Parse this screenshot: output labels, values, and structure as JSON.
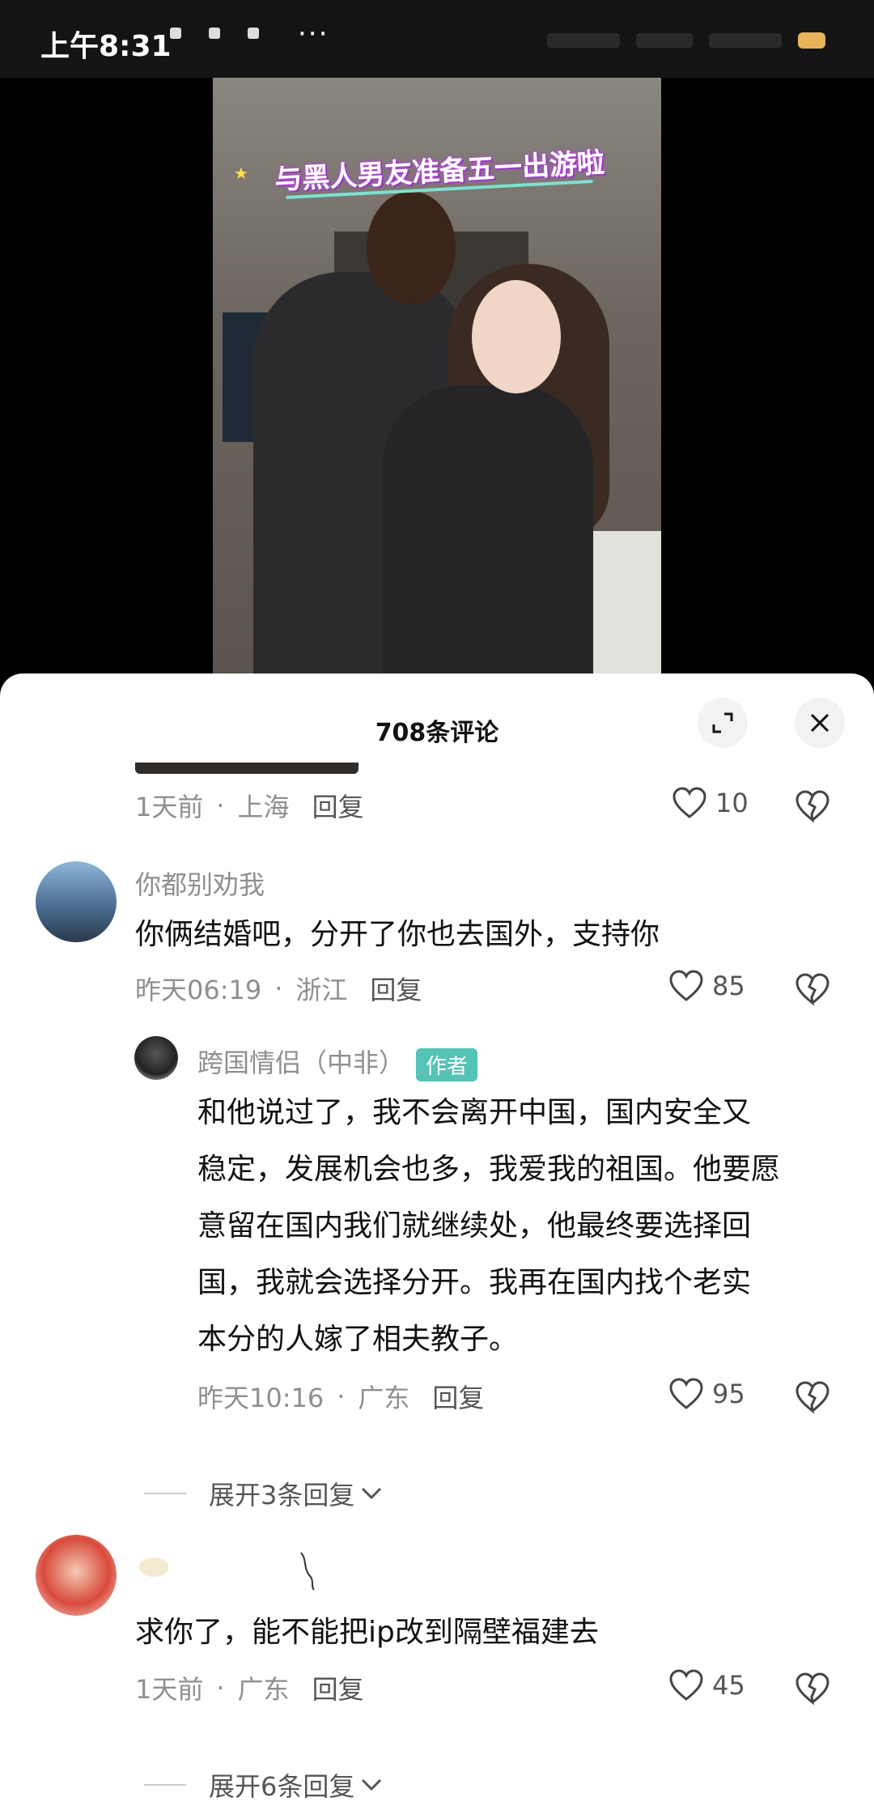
{
  "status_bar": {
    "time": "上午8:31",
    "more": "···"
  },
  "video": {
    "caption": "与黑人男友准备五一出游啦"
  },
  "comments_sheet": {
    "title": "708条评论",
    "expand_icon": "expand-icon",
    "close_icon": "close-icon",
    "first_meta": {
      "time": "1天前",
      "location": "上海",
      "reply": "回复",
      "likes": "10"
    },
    "comments": [
      {
        "username": "你都别劝我",
        "text": "你俩结婚吧，分开了你也去国外，支持你",
        "time": "昨天06:19",
        "location": "浙江",
        "reply": "回复",
        "likes": "85"
      },
      {
        "username": "",
        "text": "求你了，能不能把ip改到隔壁福建去",
        "time": "1天前",
        "location": "广东",
        "reply": "回复",
        "likes": "45",
        "expand": "展开6条回复"
      }
    ],
    "author_reply": {
      "username": "跨国情侣（中非）",
      "badge": "作者",
      "text_lines": [
        "和他说过了，我不会离开中国，国内安全又",
        "稳定，发展机会也多，我爱我的祖国。他要愿",
        "意留在国内我们就继续处，他最终要选择回",
        "国，我就会选择分开。我再在国内找个老实",
        "本分的人嫁了相夫教子。"
      ],
      "time": "昨天10:16",
      "location": "广东",
      "reply": "回复",
      "likes": "95"
    },
    "expand_first": "展开3条回复"
  },
  "colors": {
    "badge": "#55c3b6",
    "meta": "#8f8f8f",
    "text": "#111111"
  }
}
